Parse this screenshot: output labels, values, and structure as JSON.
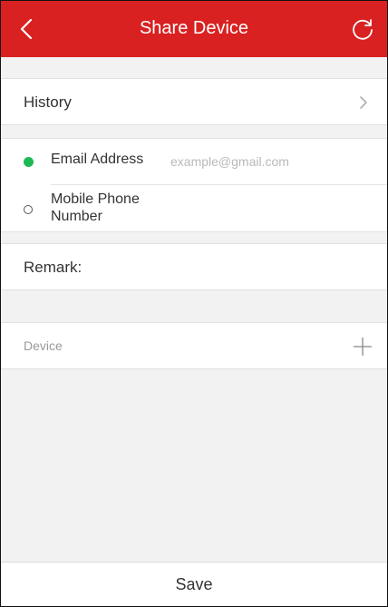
{
  "header": {
    "title": "Share Device",
    "back_icon": "chevron-left-icon",
    "refresh_icon": "refresh-icon",
    "background_color": "#d92121"
  },
  "history": {
    "label": "History",
    "icon": "chevron-right-icon"
  },
  "contact": {
    "email": {
      "label": "Email Address",
      "placeholder": "example@gmail.com",
      "value": "",
      "selected": true,
      "indicator_color": "#1db954"
    },
    "phone": {
      "label": "Mobile Phone Number",
      "selected": false
    }
  },
  "remark": {
    "label": "Remark:"
  },
  "device": {
    "label": "Device",
    "icon": "plus-icon"
  },
  "footer": {
    "save_label": "Save"
  }
}
